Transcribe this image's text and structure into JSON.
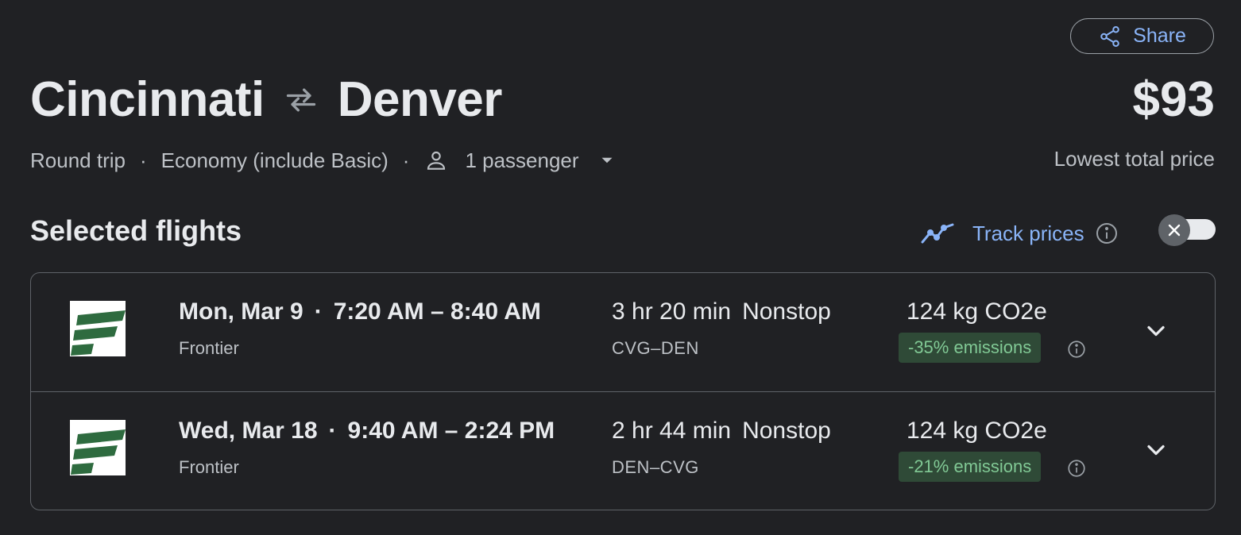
{
  "header": {
    "share_label": "Share",
    "origin": "Cincinnati",
    "destination": "Denver",
    "price": "$93",
    "price_label": "Lowest total price"
  },
  "options": {
    "trip_type": "Round trip",
    "cabin": "Economy (include Basic)",
    "passengers": "1 passenger",
    "separator": "·"
  },
  "section": {
    "title": "Selected flights",
    "track_label": "Track prices",
    "track_enabled": false
  },
  "flights": [
    {
      "date": "Mon, Mar 9",
      "separator": "·",
      "times": "7:20 AM – 8:40 AM",
      "airline": "Frontier",
      "duration": "3 hr 20 min",
      "stops": "Nonstop",
      "route": "CVG–DEN",
      "co2": "124 kg CO2e",
      "emissions": "-35% emissions"
    },
    {
      "date": "Wed, Mar 18",
      "separator": "·",
      "times": "9:40 AM – 2:24 PM",
      "airline": "Frontier",
      "duration": "2 hr 44 min",
      "stops": "Nonstop",
      "route": "DEN–CVG",
      "co2": "124 kg CO2e",
      "emissions": "-21% emissions"
    }
  ],
  "colors": {
    "background": "#202124",
    "accent": "#8ab4f8",
    "emissions_bg": "#2f4a37",
    "emissions_text": "#81c995",
    "frontier_green": "#2e6b3f"
  },
  "icons": {
    "share": "share-icon",
    "swap": "swap-arrows-icon",
    "person": "person-icon",
    "caret": "caret-down-icon",
    "trend": "trending-icon",
    "info": "info-icon",
    "close": "close-icon",
    "expand": "chevron-down-icon",
    "airline_logo": "frontier-logo"
  }
}
